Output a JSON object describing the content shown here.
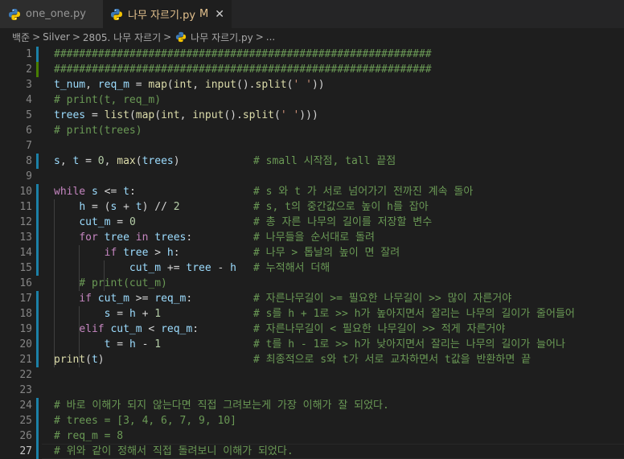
{
  "tabs": [
    {
      "label": "one_one.py",
      "active": false
    },
    {
      "label": "나무 자르기.py",
      "active": true,
      "status": "M",
      "close": "✕"
    }
  ],
  "breadcrumb": [
    "백준",
    "Silver",
    "2805. 나무 자르기",
    "나무 자르기.py",
    "..."
  ],
  "colors": {
    "comment": "#6a9955",
    "keyword": "#c586c0",
    "function": "#dcdcaa",
    "variable": "#9cdcfe",
    "number": "#b5cea8",
    "string": "#ce9178",
    "gutter_modified": "#1b81a8",
    "gutter_added": "#487e02"
  },
  "lines": [
    {
      "n": "1",
      "text": "############################################################"
    },
    {
      "n": "2",
      "text": "############################################################"
    },
    {
      "n": "3",
      "text": "t_num, req_m = map(int, input().split(' '))"
    },
    {
      "n": "4",
      "text": "# print(t, req_m)"
    },
    {
      "n": "5",
      "text": "trees = list(map(int, input().split(' ')))"
    },
    {
      "n": "6",
      "text": "# print(trees)"
    },
    {
      "n": "7",
      "text": ""
    },
    {
      "n": "8",
      "text": "s, t = 0, max(trees)",
      "comment": "# small 시작점, tall 끝점"
    },
    {
      "n": "9",
      "text": ""
    },
    {
      "n": "10",
      "text": "while s <= t:",
      "comment": "# s 와 t 가 서로 넘어가기 전까진 계속 돌아"
    },
    {
      "n": "11",
      "text": "    h = (s + t) // 2",
      "comment": "# s, t의 중간값으로 높이 h를 잡아"
    },
    {
      "n": "12",
      "text": "    cut_m = 0",
      "comment": "# 총 자른 나무의 길이를 저장할 변수"
    },
    {
      "n": "13",
      "text": "    for tree in trees:",
      "comment": "# 나무들을 순서대로 돌려"
    },
    {
      "n": "14",
      "text": "        if tree > h:",
      "comment": "# 나무 > 톱날의 높이 면 잘려"
    },
    {
      "n": "15",
      "text": "            cut_m += tree - h",
      "comment": "# 누적해서 더해"
    },
    {
      "n": "16",
      "text": "    # print(cut_m)"
    },
    {
      "n": "17",
      "text": "    if cut_m >= req_m:",
      "comment": "# 자른나무길이 >= 필요한 나무길이 >> 많이 자른거야"
    },
    {
      "n": "18",
      "text": "        s = h + 1",
      "comment": "# s를 h + 1로 >> h가 높아지면서 잘리는 나무의 길이가 줄어들어"
    },
    {
      "n": "19",
      "text": "    elif cut_m < req_m:",
      "comment": "# 자른나무길이 < 필요한 나무길이 >> 적게 자른거야"
    },
    {
      "n": "20",
      "text": "        t = h - 1",
      "comment": "# t를 h - 1로 >> h가 낮아지면서 잘리는 나무의 길이가 늘어나"
    },
    {
      "n": "21",
      "text": "print(t)",
      "comment": "# 최종적으로 s와 t가 서로 교차하면서 t값을 반환하면 끝"
    },
    {
      "n": "22",
      "text": ""
    },
    {
      "n": "23",
      "text": ""
    },
    {
      "n": "24",
      "text": "# 바로 이해가 되지 않는다면 직접 그려보는게 가장 이해가 잘 되었다."
    },
    {
      "n": "25",
      "text": "# trees = [3, 4, 6, 7, 9, 10]"
    },
    {
      "n": "26",
      "text": "# req_m = 8"
    },
    {
      "n": "27",
      "text": "# 위와 같이 정해서 직접 돌려보니 이해가 되었다."
    }
  ]
}
